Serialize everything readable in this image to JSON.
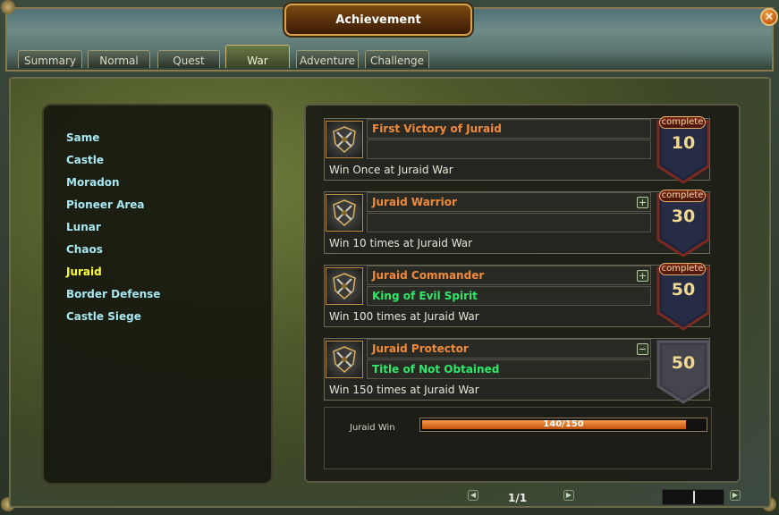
{
  "window": {
    "title": "Achievement",
    "close_icon_glyph": "✕"
  },
  "tabs": [
    {
      "label": "Summary",
      "active": false
    },
    {
      "label": "Normal",
      "active": false
    },
    {
      "label": "Quest",
      "active": false
    },
    {
      "label": "War",
      "active": true
    },
    {
      "label": "Adventure",
      "active": false
    },
    {
      "label": "Challenge",
      "active": false
    }
  ],
  "sidebar": {
    "items": [
      {
        "label": "Same",
        "active": false
      },
      {
        "label": "Castle",
        "active": false
      },
      {
        "label": "Moradon",
        "active": false
      },
      {
        "label": "Pioneer Area",
        "active": false
      },
      {
        "label": "Lunar",
        "active": false
      },
      {
        "label": "Chaos",
        "active": false
      },
      {
        "label": "Juraid",
        "active": true
      },
      {
        "label": "Border Defense",
        "active": false
      },
      {
        "label": "Castle Siege",
        "active": false
      }
    ]
  },
  "achievements": [
    {
      "title": "First Victory of Juraid",
      "reward": "",
      "description": "Win Once at Juraid War",
      "status": "complete",
      "points": "10",
      "toggle": ""
    },
    {
      "title": "Juraid Warrior",
      "reward": "",
      "description": "Win 10 times at Juraid War",
      "status": "complete",
      "points": "30",
      "toggle": "+"
    },
    {
      "title": "Juraid Commander",
      "reward": "King of Evil Spirit",
      "description": "Win 100 times at Juraid War",
      "status": "complete",
      "points": "50",
      "toggle": "+"
    },
    {
      "title": "Juraid Protector",
      "reward": "Title of Not Obtained",
      "description": "Win 150 times at Juraid War",
      "status": "",
      "points": "50",
      "toggle": "−"
    }
  ],
  "progress": {
    "label": "Juraid Win",
    "text": "140/150",
    "fraction": 0.933
  },
  "pagination": {
    "page_text": "1/1",
    "prev_icon_glyph": "◀",
    "next_icon_glyph": "▶"
  },
  "colors": {
    "title_orange": "#f08a3a",
    "reward_green": "#2ee86a",
    "sidebar_cyan": "#a8e8f2",
    "sidebar_active": "#ffff3c",
    "progress_fill": "#e8752a"
  }
}
